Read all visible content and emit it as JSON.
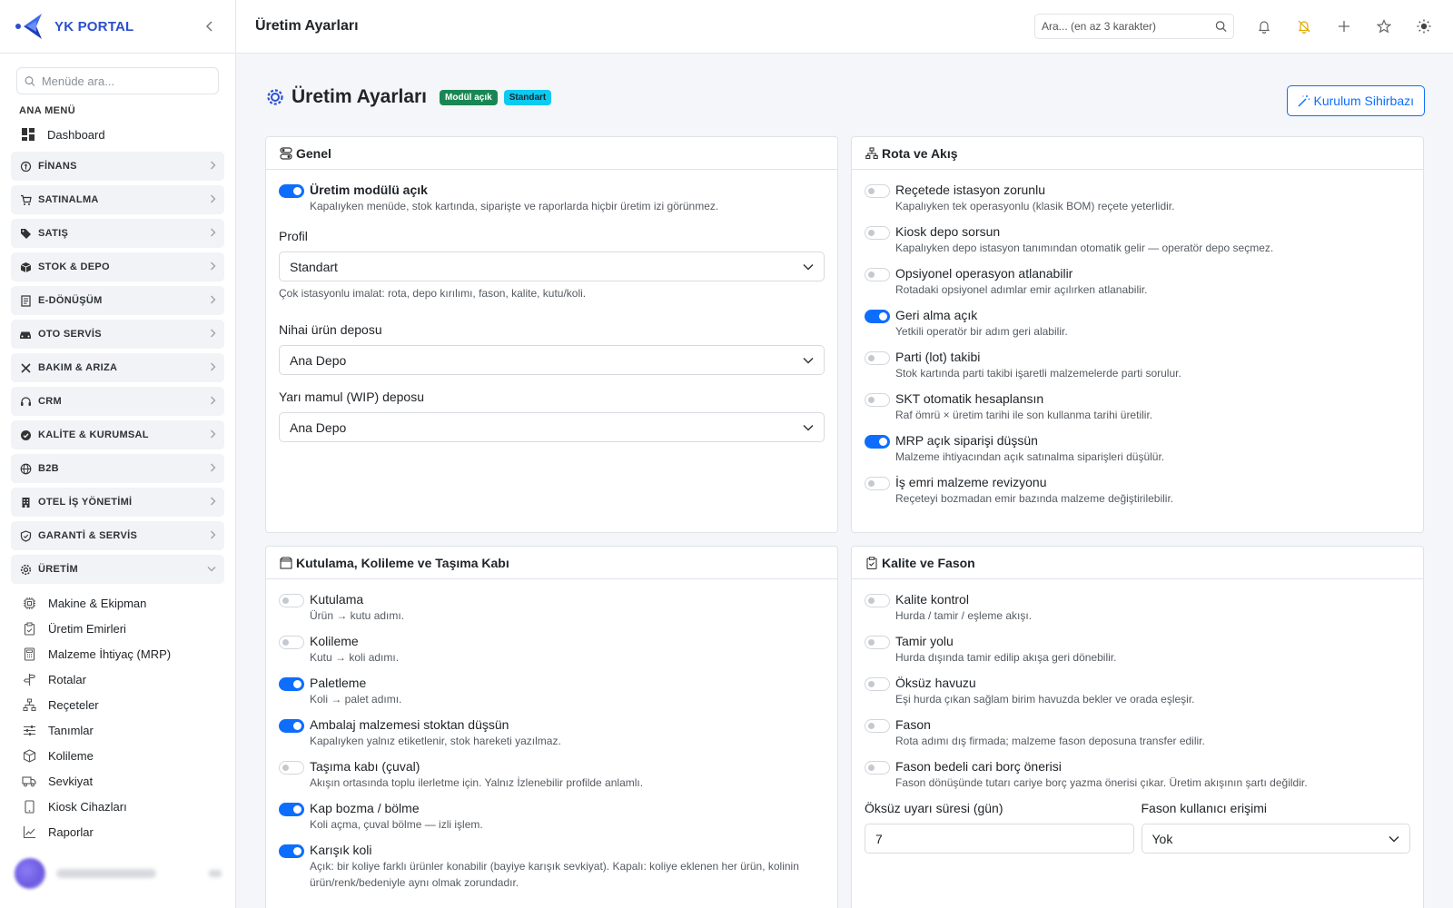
{
  "brand": {
    "name": "YK PORTAL"
  },
  "sidebar": {
    "search_placeholder": "Menüde ara...",
    "section_title": "ANA MENÜ",
    "dashboard": "Dashboard",
    "groups": [
      {
        "label": "FİNANS",
        "icon": "finance-icon"
      },
      {
        "label": "SATINALMA",
        "icon": "cart-icon"
      },
      {
        "label": "SATIŞ",
        "icon": "tag-icon"
      },
      {
        "label": "STOK & DEPO",
        "icon": "box-icon"
      },
      {
        "label": "E-DÖNÜŞÜM",
        "icon": "document-icon"
      },
      {
        "label": "OTO SERVİS",
        "icon": "car-icon"
      },
      {
        "label": "BAKIM & ARIZA",
        "icon": "tools-icon"
      },
      {
        "label": "CRM",
        "icon": "headset-icon"
      },
      {
        "label": "KALİTE & KURUMSAL",
        "icon": "check-badge-icon"
      },
      {
        "label": "B2B",
        "icon": "globe-icon"
      },
      {
        "label": "OTEL İŞ YÖNETİMİ",
        "icon": "building-icon"
      },
      {
        "label": "GARANTİ & SERVİS",
        "icon": "shield-icon"
      },
      {
        "label": "ÜRETİM",
        "icon": "gear-icon"
      }
    ],
    "production_items": [
      {
        "label": "Makine & Ekipman",
        "icon": "cpu-icon"
      },
      {
        "label": "Üretim Emirleri",
        "icon": "clipboard-icon"
      },
      {
        "label": "Malzeme İhtiyaç (MRP)",
        "icon": "calculator-icon"
      },
      {
        "label": "Rotalar",
        "icon": "signpost-icon"
      },
      {
        "label": "Reçeteler",
        "icon": "diagram-icon"
      },
      {
        "label": "Tanımlar",
        "icon": "sliders-icon"
      },
      {
        "label": "Kolileme",
        "icon": "package-icon"
      },
      {
        "label": "Sevkiyat",
        "icon": "truck-icon"
      },
      {
        "label": "Kiosk Cihazları",
        "icon": "tablet-icon"
      },
      {
        "label": "Raporlar",
        "icon": "chart-line-icon"
      }
    ]
  },
  "topbar": {
    "title": "Üretim Ayarları",
    "search_placeholder": "Ara... (en az 3 karakter)"
  },
  "page": {
    "title": "Üretim Ayarları",
    "badge_module": "Modül açık",
    "badge_profile": "Standart",
    "wizard_button": "Kurulum Sihirbazı"
  },
  "general": {
    "title": "Genel",
    "module_toggle": {
      "label": "Üretim modülü açık",
      "desc": "Kapalıyken menüde, stok kartında, siparişte ve raporlarda hiçbir üretim izi görünmez.",
      "on": true
    },
    "profile_label": "Profil",
    "profile_value": "Standart",
    "profile_help": "Çok istasyonlu imalat: rota, depo kırılımı, fason, kalite, kutu/koli.",
    "final_depot_label": "Nihai ürün deposu",
    "final_depot_value": "Ana Depo",
    "wip_depot_label": "Yarı mamul (WIP) deposu",
    "wip_depot_value": "Ana Depo"
  },
  "route": {
    "title": "Rota ve Akış",
    "toggles": [
      {
        "label": "Reçetede istasyon zorunlu",
        "desc": "Kapalıyken tek operasyonlu (klasik BOM) reçete yeterlidir.",
        "on": false
      },
      {
        "label": "Kiosk depo sorsun",
        "desc": "Kapalıyken depo istasyon tanımından otomatik gelir — operatör depo seçmez.",
        "on": false
      },
      {
        "label": "Opsiyonel operasyon atlanabilir",
        "desc": "Rotadaki opsiyonel adımlar emir açılırken atlanabilir.",
        "on": false
      },
      {
        "label": "Geri alma açık",
        "desc": "Yetkili operatör bir adım geri alabilir.",
        "on": true
      },
      {
        "label": "Parti (lot) takibi",
        "desc": "Stok kartında parti takibi işaretli malzemelerde parti sorulur.",
        "on": false
      },
      {
        "label": "SKT otomatik hesaplansın",
        "desc": "Raf ömrü × üretim tarihi ile son kullanma tarihi üretilir.",
        "on": false
      },
      {
        "label": "MRP açık siparişi düşsün",
        "desc": "Malzeme ihtiyacından açık satınalma siparişleri düşülür.",
        "on": true
      },
      {
        "label": "İş emri malzeme revizyonu",
        "desc": "Reçeteyi bozmadan emir bazında malzeme değiştirilebilir.",
        "on": false
      }
    ]
  },
  "packing": {
    "title": "Kutulama, Kolileme ve Taşıma Kabı",
    "toggles": [
      {
        "label": "Kutulama",
        "desc": "Ürün → kutu adımı.",
        "on": false
      },
      {
        "label": "Kolileme",
        "desc": "Kutu → koli adımı.",
        "on": false
      },
      {
        "label": "Paletleme",
        "desc": "Koli → palet adımı.",
        "on": true
      },
      {
        "label": "Ambalaj malzemesi stoktan düşsün",
        "desc": "Kapalıyken yalnız etiketlenir, stok hareketi yazılmaz.",
        "on": true
      },
      {
        "label": "Taşıma kabı (çuval)",
        "desc": "Akışın ortasında toplu ilerletme için. Yalnız İzlenebilir profilde anlamlı.",
        "on": false
      },
      {
        "label": "Kap bozma / bölme",
        "desc": "Koli açma, çuval bölme — izli işlem.",
        "on": true
      },
      {
        "label": "Karışık koli",
        "desc": "Açık: bir koliye farklı ürünler konabilir (bayiye karışık sevkiyat). Kapalı: koliye eklenen her ürün, kolinin ürün/renk/bedeniyle aynı olmak zorundadır.",
        "on": true
      }
    ]
  },
  "quality": {
    "title": "Kalite ve Fason",
    "toggles": [
      {
        "label": "Kalite kontrol",
        "desc": "Hurda / tamir / eşleme akışı.",
        "on": false
      },
      {
        "label": "Tamir yolu",
        "desc": "Hurda dışında tamir edilip akışa geri dönebilir.",
        "on": false
      },
      {
        "label": "Öksüz havuzu",
        "desc": "Eşi hurda çıkan sağlam birim havuzda bekler ve orada eşleşir.",
        "on": false
      },
      {
        "label": "Fason",
        "desc": "Rota adımı dış firmada; malzeme fason deposuna transfer edilir.",
        "on": false
      },
      {
        "label": "Fason bedeli cari borç önerisi",
        "desc": "Fason dönüşünde tutarı cariye borç yazma önerisi çıkar. Üretim akışının şartı değildir.",
        "on": false
      }
    ],
    "orphan_label": "Öksüz uyarı süresi (gün)",
    "orphan_value": "7",
    "fason_access_label": "Fason kullanıcı erişimi",
    "fason_access_value": "Yok"
  },
  "colors": {
    "primary": "#0d6efd",
    "success": "#198754",
    "info": "#0dcaf0",
    "brand": "#2b4fcf"
  }
}
